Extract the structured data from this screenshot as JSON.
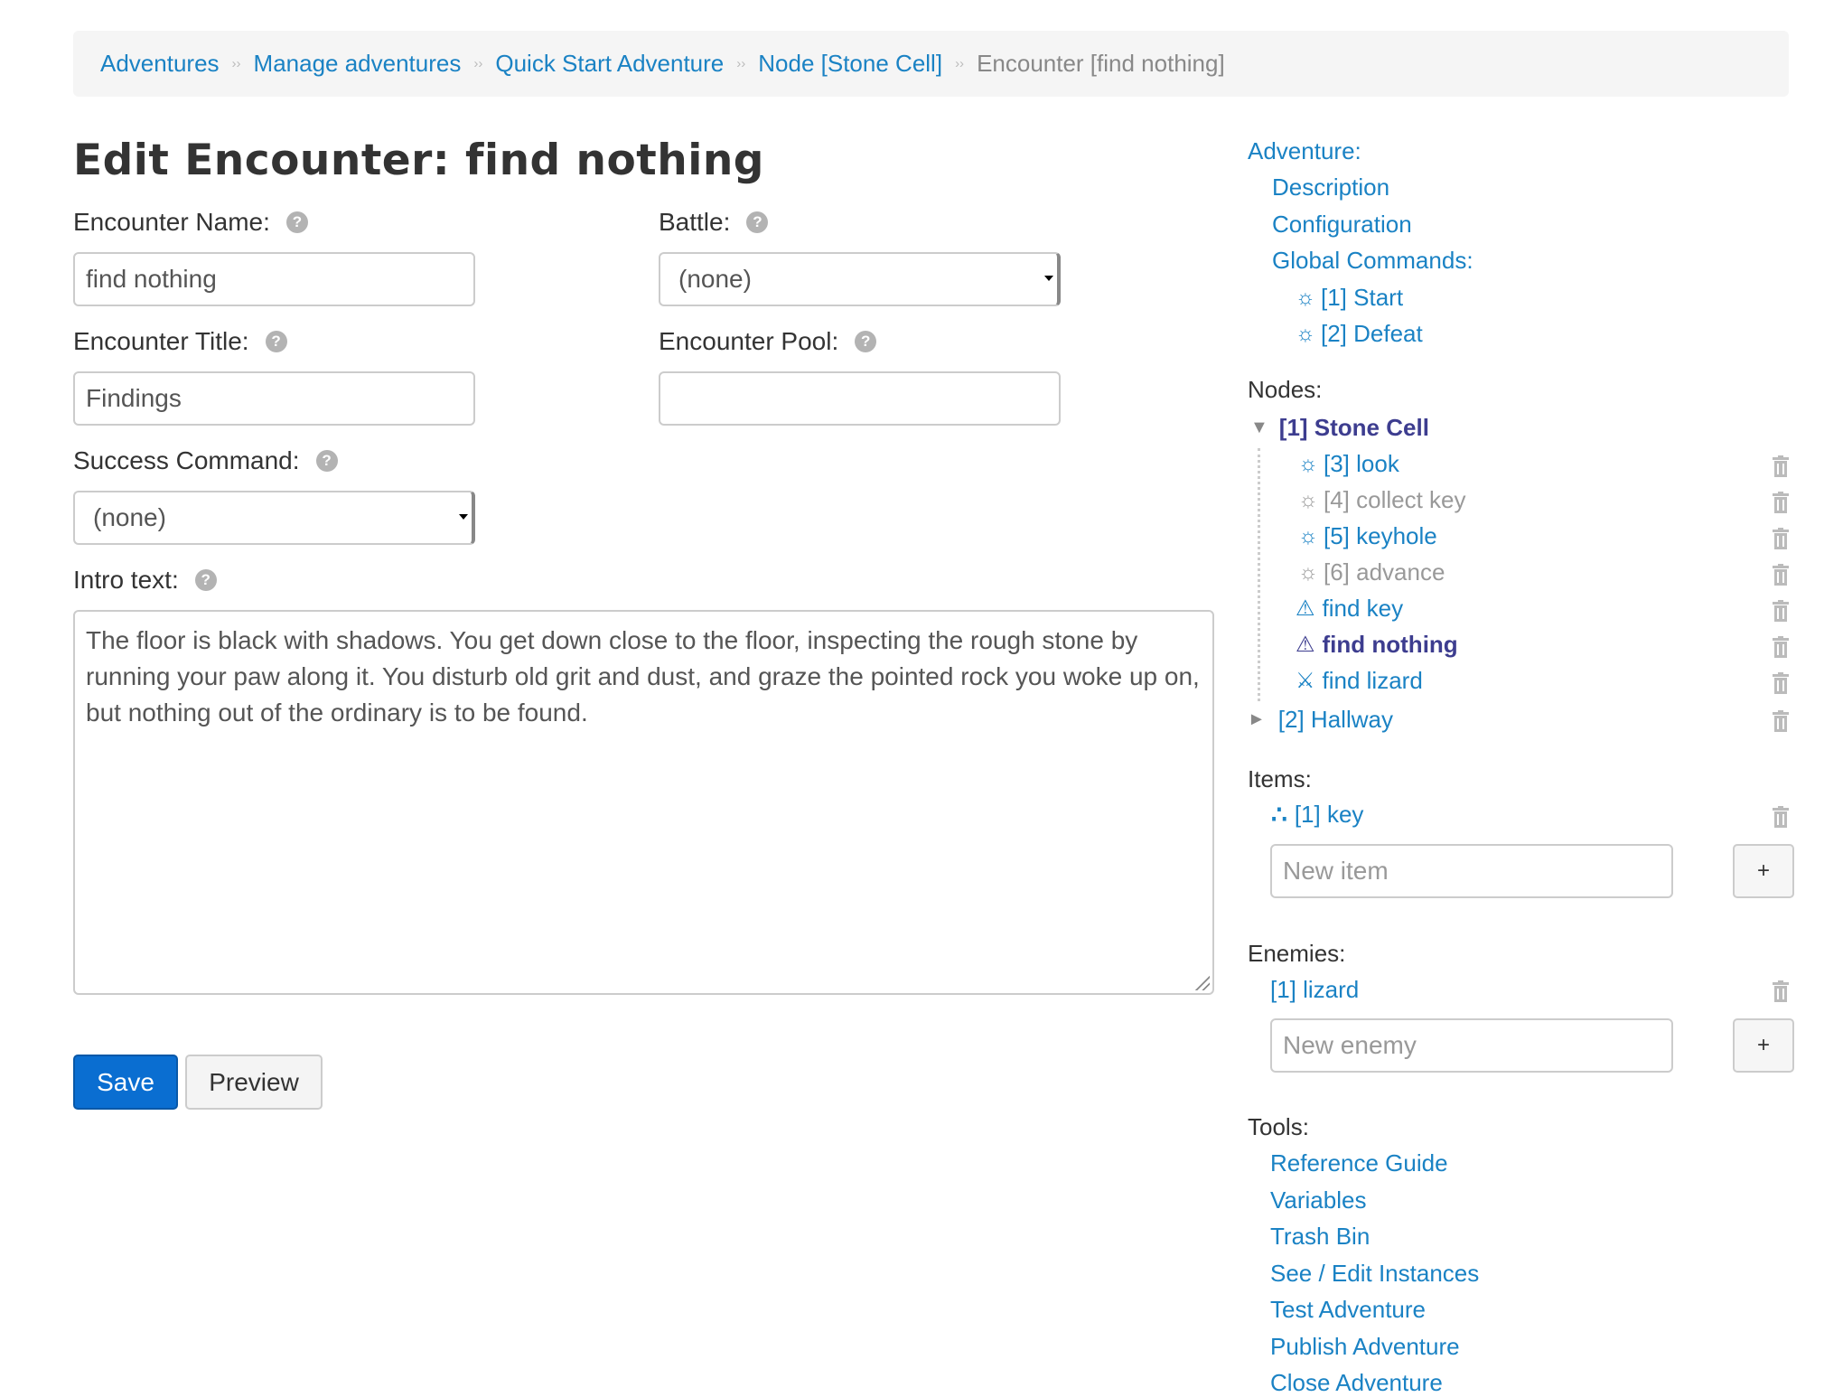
{
  "breadcrumb": {
    "items": [
      "Adventures",
      "Manage adventures",
      "Quick Start Adventure",
      "Node [Stone Cell]"
    ],
    "separator": "››",
    "current": "Encounter [find nothing]"
  },
  "page_title": "Edit Encounter: find nothing",
  "help_glyph": "?",
  "form": {
    "encounter_name_label": "Encounter Name:",
    "encounter_name_value": "find nothing",
    "battle_label": "Battle:",
    "battle_value": "(none)",
    "encounter_title_label": "Encounter Title:",
    "encounter_title_value": "Findings",
    "encounter_pool_label": "Encounter Pool:",
    "encounter_pool_value": "",
    "success_command_label": "Success Command:",
    "success_command_value": "(none)",
    "intro_text_label": "Intro text:",
    "intro_text_value": "The floor is black with shadows. You get down close to the floor, inspecting the rough stone by running your paw along it. You disturb old grit and dust, and graze the pointed rock you woke up on, but nothing out of the ordinary is to be found.",
    "save_label": "Save",
    "preview_label": "Preview"
  },
  "sidebar": {
    "adventure_heading": "Adventure:",
    "description": "Description",
    "configuration": "Configuration",
    "global_commands_heading": "Global Commands:",
    "global_commands": [
      "[1] Start",
      "[2] Defeat"
    ],
    "nodes_heading": "Nodes:",
    "node1": "[1] Stone Cell",
    "node1_children": [
      {
        "label": "[3] look",
        "icon": "gear-icon"
      },
      {
        "label": "[4] collect key",
        "icon": "gear-icon"
      },
      {
        "label": "[5] keyhole",
        "icon": "gear-icon"
      },
      {
        "label": "[6] advance",
        "icon": "gear-icon"
      },
      {
        "label": "find key",
        "icon": "warning-icon"
      },
      {
        "label": "find nothing",
        "icon": "warning-icon"
      },
      {
        "label": "find lizard",
        "icon": "swords-icon"
      }
    ],
    "node2": "[2] Hallway",
    "items_heading": "Items:",
    "items": [
      "[1] key"
    ],
    "new_item_placeholder": "New item",
    "enemies_heading": "Enemies:",
    "enemies": [
      "[1] lizard"
    ],
    "new_enemy_placeholder": "New enemy",
    "add_glyph": "+",
    "tools_heading": "Tools:",
    "tools": [
      "Reference Guide",
      "Variables",
      "Trash Bin",
      "See / Edit Instances",
      "Test Adventure",
      "Publish Adventure",
      "Close Adventure"
    ]
  },
  "glyphs": {
    "gear": "☼",
    "warning": "⚠",
    "swords": "⚔",
    "expanded": "▼",
    "collapsed": "►",
    "item": "∴"
  },
  "colors": {
    "link": "#1a82c4",
    "active": "#3d3d8f",
    "primary": "#0a6ed1",
    "muted": "#999999"
  }
}
